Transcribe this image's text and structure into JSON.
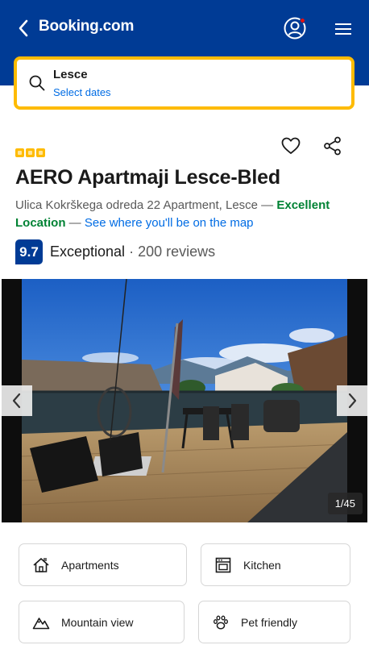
{
  "header": {
    "logo": "Booking.com",
    "background": "#003b95"
  },
  "search": {
    "destination": "Lesce",
    "dates": "Select dates",
    "border_color": "#febb02"
  },
  "property": {
    "star_count": 3,
    "name": "AERO Apartmaji Lesce-Bled",
    "address": "Ulica Kokrškega odreda 22 Apartment, Lesce",
    "dash1": " — ",
    "location_rating": "Excellent Location",
    "dash2": " — ",
    "map_link": "See where you'll be on the map",
    "score": "9.7",
    "score_word": "Exceptional",
    "score_separator": "·",
    "reviews": "200 reviews"
  },
  "gallery": {
    "counter": "1/45"
  },
  "facilities": [
    {
      "label": "Apartments",
      "icon": "house-icon"
    },
    {
      "label": "Kitchen",
      "icon": "oven-icon"
    },
    {
      "label": "Mountain view",
      "icon": "mountain-icon"
    },
    {
      "label": "Pet friendly",
      "icon": "paw-icon"
    }
  ],
  "colors": {
    "brand_blue": "#003b95",
    "link_blue": "#006ce4",
    "accent_yellow": "#febb02",
    "positive_green": "#008234"
  }
}
